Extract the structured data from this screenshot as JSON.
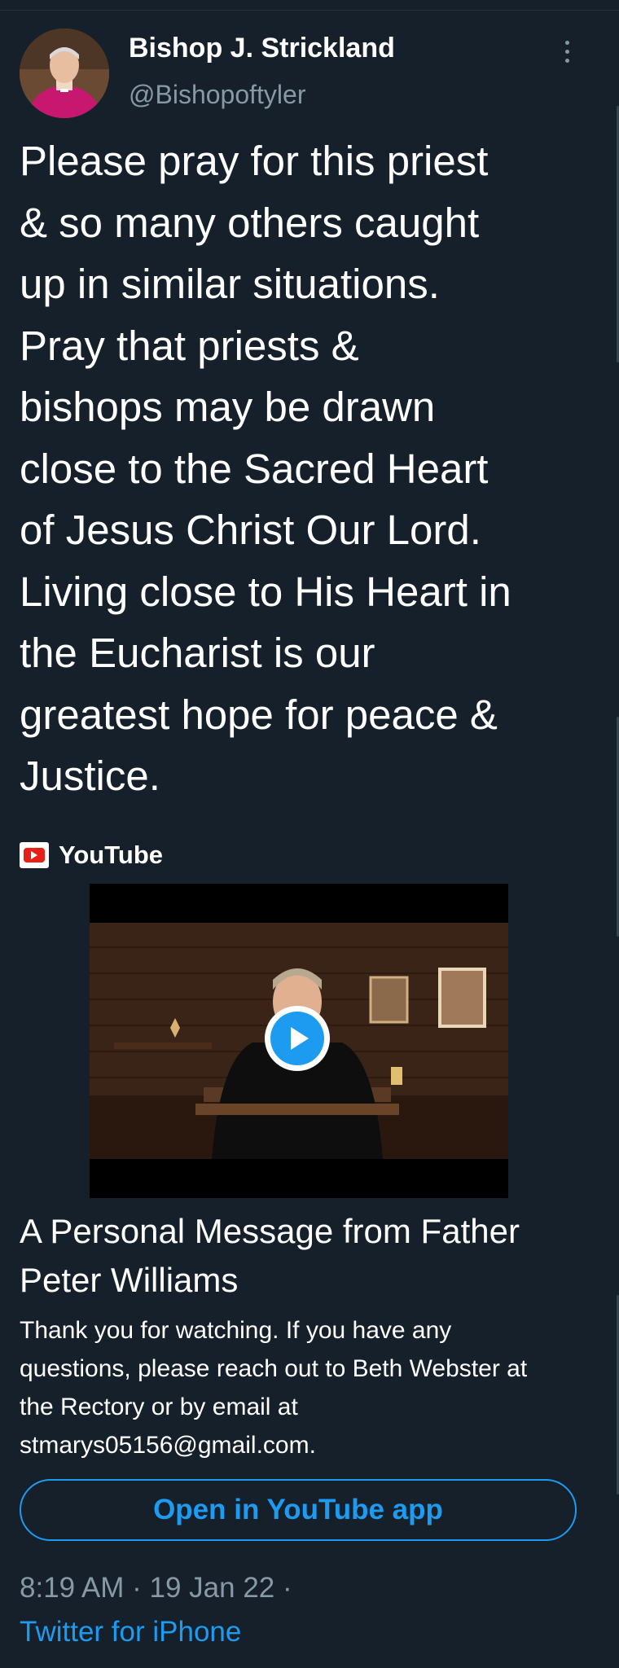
{
  "tweet": {
    "author_name": "Bishop J. Strickland",
    "author_handle": "@Bishopoftyler",
    "text": "Please pray for this priest\n& so many others caught\nup in similar situations.\nPray that priests &\nbishops may be drawn\nclose to the Sacred Heart\nof Jesus Christ Our Lord.\nLiving close to His Heart in\nthe Eucharist is our\ngreatest hope for peace &\nJustice.",
    "timestamp": "8:19 AM · 19 Jan 22 ·",
    "source": "Twitter for iPhone"
  },
  "card": {
    "provider": "YouTube",
    "title": "A Personal Message from Father Peter Williams",
    "description": "Thank you for watching. If you have any questions, please reach out to Beth Webster at the Rectory or by email at stmarys05156@gmail.com.",
    "open_button": "Open in YouTube app"
  },
  "colors": {
    "background": "#15202b",
    "accent": "#1d9bf0",
    "secondary_text": "#8899a6",
    "youtube_red": "#e62117"
  },
  "icons": {
    "avatar": "profile-photo",
    "more": "more-vertical-icon",
    "provider": "youtube-logo-icon",
    "play": "play-icon"
  }
}
